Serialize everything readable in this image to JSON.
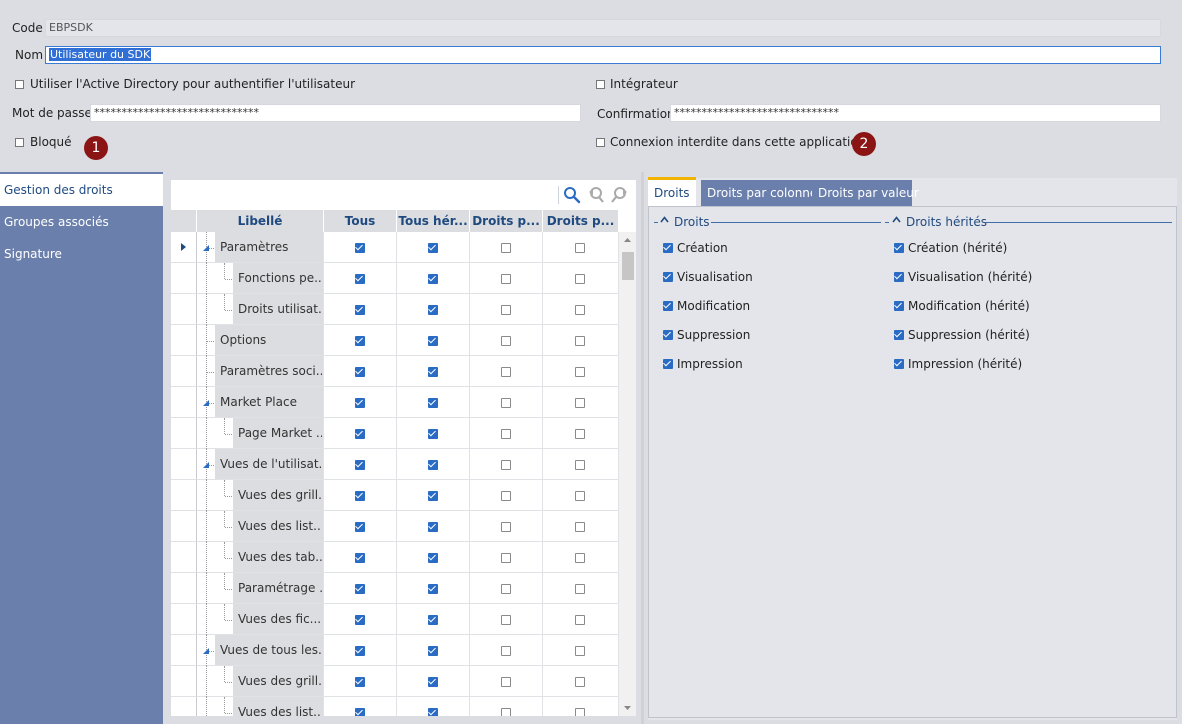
{
  "form": {
    "code_label": "Code",
    "code_value": "EBPSDK",
    "nom_label": "Nom",
    "nom_value": "Utilisateur du SDK",
    "active_directory_label": "Utiliser l'Active Directory pour authentifier l'utilisateur",
    "integrateur_label": "Intégrateur",
    "password_label": "Mot de passe",
    "password_value": "******************************",
    "confirmation_label": "Confirmation",
    "confirmation_value": "******************************",
    "bloque_label": "Bloqué",
    "connexion_label": "Connexion interdite dans cette application",
    "badge1": "1",
    "badge2": "2"
  },
  "sidebar": {
    "items": [
      {
        "label": "Gestion des droits",
        "active": true
      },
      {
        "label": "Groupes associés",
        "active": false
      },
      {
        "label": "Signature",
        "active": false
      }
    ]
  },
  "grid": {
    "headers": [
      "Libellé",
      "Tous",
      "Tous hér...",
      "Droits p...",
      "Droits p..."
    ],
    "rows": [
      {
        "label": "Paramètres",
        "level": 0,
        "expand": true,
        "cols": [
          true,
          true,
          false,
          false
        ]
      },
      {
        "label": "Fonctions pe...",
        "level": 1,
        "expand": false,
        "cols": [
          true,
          true,
          false,
          false
        ]
      },
      {
        "label": "Droits utilisat...",
        "level": 1,
        "expand": false,
        "cols": [
          true,
          true,
          false,
          false
        ]
      },
      {
        "label": "Options",
        "level": 0,
        "expand": false,
        "cols": [
          true,
          true,
          false,
          false
        ]
      },
      {
        "label": "Paramètres soci...",
        "level": 0,
        "expand": false,
        "cols": [
          true,
          true,
          false,
          false
        ]
      },
      {
        "label": "Market Place",
        "level": 0,
        "expand": true,
        "cols": [
          true,
          true,
          false,
          false
        ]
      },
      {
        "label": "Page Market ...",
        "level": 1,
        "expand": false,
        "cols": [
          true,
          true,
          false,
          false
        ]
      },
      {
        "label": "Vues de l'utilisat...",
        "level": 0,
        "expand": true,
        "cols": [
          true,
          true,
          false,
          false
        ]
      },
      {
        "label": "Vues des grill...",
        "level": 1,
        "expand": false,
        "cols": [
          true,
          true,
          false,
          false
        ]
      },
      {
        "label": "Vues des list...",
        "level": 1,
        "expand": false,
        "cols": [
          true,
          true,
          false,
          false
        ]
      },
      {
        "label": "Vues des tab...",
        "level": 1,
        "expand": false,
        "cols": [
          true,
          true,
          false,
          false
        ]
      },
      {
        "label": "Paramétrage ...",
        "level": 1,
        "expand": false,
        "cols": [
          true,
          true,
          false,
          false
        ]
      },
      {
        "label": "Vues des fic...",
        "level": 1,
        "expand": false,
        "cols": [
          true,
          true,
          false,
          false
        ]
      },
      {
        "label": "Vues de tous les...",
        "level": 0,
        "expand": true,
        "cols": [
          true,
          true,
          false,
          false
        ]
      },
      {
        "label": "Vues des grill...",
        "level": 1,
        "expand": false,
        "cols": [
          true,
          true,
          false,
          false
        ]
      },
      {
        "label": "Vues des list...",
        "level": 1,
        "expand": false,
        "cols": [
          true,
          true,
          false,
          false
        ]
      }
    ]
  },
  "right": {
    "tabs": [
      {
        "label": "Droits",
        "active": true
      },
      {
        "label": "Droits par colonne",
        "active": false
      },
      {
        "label": "Droits par valeur",
        "active": false
      }
    ],
    "group1_title": "Droits",
    "group2_title": "Droits hérités",
    "droits": [
      "Création",
      "Visualisation",
      "Modification",
      "Suppression",
      "Impression"
    ],
    "droits_herites": [
      "Création (hérité)",
      "Visualisation (hérité)",
      "Modification (hérité)",
      "Suppression (hérité)",
      "Impression (hérité)"
    ]
  },
  "colors": {
    "sidebar": "#6a7fac",
    "accent": "#2a6bc4",
    "badge": "#8b1414",
    "tab_highlight": "#f0b400"
  }
}
